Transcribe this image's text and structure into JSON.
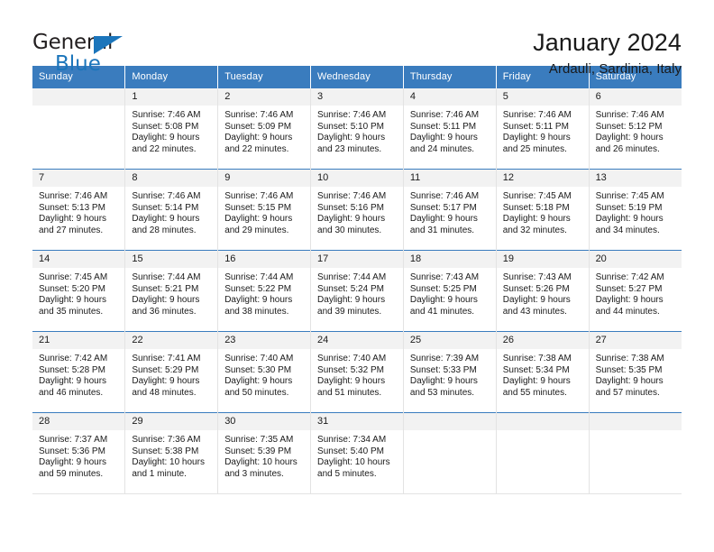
{
  "brand": {
    "name_part1": "General",
    "name_part2": "Blue",
    "triangle_color": "#1b75bb"
  },
  "header": {
    "title": "January 2024",
    "location": "Ardauli, Sardinia, Italy"
  },
  "theme": {
    "header_bg": "#3a7cbe",
    "header_text": "#ffffff",
    "daynum_bg": "#f2f2f2",
    "cell_bg": "#ffffff",
    "grid_line": "#e3e3e3",
    "row_rule": "#3a7cbe"
  },
  "weekdays": [
    "Sunday",
    "Monday",
    "Tuesday",
    "Wednesday",
    "Thursday",
    "Friday",
    "Saturday"
  ],
  "labels": {
    "sunrise_prefix": "Sunrise:",
    "sunset_prefix": "Sunset:",
    "daylight_prefix": "Daylight:"
  },
  "weeks": [
    [
      {
        "day": "",
        "sunrise": "",
        "sunset": "",
        "daylight_line1": "",
        "daylight_line2": ""
      },
      {
        "day": "1",
        "sunrise": "Sunrise: 7:46 AM",
        "sunset": "Sunset: 5:08 PM",
        "daylight_line1": "Daylight: 9 hours",
        "daylight_line2": "and 22 minutes."
      },
      {
        "day": "2",
        "sunrise": "Sunrise: 7:46 AM",
        "sunset": "Sunset: 5:09 PM",
        "daylight_line1": "Daylight: 9 hours",
        "daylight_line2": "and 22 minutes."
      },
      {
        "day": "3",
        "sunrise": "Sunrise: 7:46 AM",
        "sunset": "Sunset: 5:10 PM",
        "daylight_line1": "Daylight: 9 hours",
        "daylight_line2": "and 23 minutes."
      },
      {
        "day": "4",
        "sunrise": "Sunrise: 7:46 AM",
        "sunset": "Sunset: 5:11 PM",
        "daylight_line1": "Daylight: 9 hours",
        "daylight_line2": "and 24 minutes."
      },
      {
        "day": "5",
        "sunrise": "Sunrise: 7:46 AM",
        "sunset": "Sunset: 5:11 PM",
        "daylight_line1": "Daylight: 9 hours",
        "daylight_line2": "and 25 minutes."
      },
      {
        "day": "6",
        "sunrise": "Sunrise: 7:46 AM",
        "sunset": "Sunset: 5:12 PM",
        "daylight_line1": "Daylight: 9 hours",
        "daylight_line2": "and 26 minutes."
      }
    ],
    [
      {
        "day": "7",
        "sunrise": "Sunrise: 7:46 AM",
        "sunset": "Sunset: 5:13 PM",
        "daylight_line1": "Daylight: 9 hours",
        "daylight_line2": "and 27 minutes."
      },
      {
        "day": "8",
        "sunrise": "Sunrise: 7:46 AM",
        "sunset": "Sunset: 5:14 PM",
        "daylight_line1": "Daylight: 9 hours",
        "daylight_line2": "and 28 minutes."
      },
      {
        "day": "9",
        "sunrise": "Sunrise: 7:46 AM",
        "sunset": "Sunset: 5:15 PM",
        "daylight_line1": "Daylight: 9 hours",
        "daylight_line2": "and 29 minutes."
      },
      {
        "day": "10",
        "sunrise": "Sunrise: 7:46 AM",
        "sunset": "Sunset: 5:16 PM",
        "daylight_line1": "Daylight: 9 hours",
        "daylight_line2": "and 30 minutes."
      },
      {
        "day": "11",
        "sunrise": "Sunrise: 7:46 AM",
        "sunset": "Sunset: 5:17 PM",
        "daylight_line1": "Daylight: 9 hours",
        "daylight_line2": "and 31 minutes."
      },
      {
        "day": "12",
        "sunrise": "Sunrise: 7:45 AM",
        "sunset": "Sunset: 5:18 PM",
        "daylight_line1": "Daylight: 9 hours",
        "daylight_line2": "and 32 minutes."
      },
      {
        "day": "13",
        "sunrise": "Sunrise: 7:45 AM",
        "sunset": "Sunset: 5:19 PM",
        "daylight_line1": "Daylight: 9 hours",
        "daylight_line2": "and 34 minutes."
      }
    ],
    [
      {
        "day": "14",
        "sunrise": "Sunrise: 7:45 AM",
        "sunset": "Sunset: 5:20 PM",
        "daylight_line1": "Daylight: 9 hours",
        "daylight_line2": "and 35 minutes."
      },
      {
        "day": "15",
        "sunrise": "Sunrise: 7:44 AM",
        "sunset": "Sunset: 5:21 PM",
        "daylight_line1": "Daylight: 9 hours",
        "daylight_line2": "and 36 minutes."
      },
      {
        "day": "16",
        "sunrise": "Sunrise: 7:44 AM",
        "sunset": "Sunset: 5:22 PM",
        "daylight_line1": "Daylight: 9 hours",
        "daylight_line2": "and 38 minutes."
      },
      {
        "day": "17",
        "sunrise": "Sunrise: 7:44 AM",
        "sunset": "Sunset: 5:24 PM",
        "daylight_line1": "Daylight: 9 hours",
        "daylight_line2": "and 39 minutes."
      },
      {
        "day": "18",
        "sunrise": "Sunrise: 7:43 AM",
        "sunset": "Sunset: 5:25 PM",
        "daylight_line1": "Daylight: 9 hours",
        "daylight_line2": "and 41 minutes."
      },
      {
        "day": "19",
        "sunrise": "Sunrise: 7:43 AM",
        "sunset": "Sunset: 5:26 PM",
        "daylight_line1": "Daylight: 9 hours",
        "daylight_line2": "and 43 minutes."
      },
      {
        "day": "20",
        "sunrise": "Sunrise: 7:42 AM",
        "sunset": "Sunset: 5:27 PM",
        "daylight_line1": "Daylight: 9 hours",
        "daylight_line2": "and 44 minutes."
      }
    ],
    [
      {
        "day": "21",
        "sunrise": "Sunrise: 7:42 AM",
        "sunset": "Sunset: 5:28 PM",
        "daylight_line1": "Daylight: 9 hours",
        "daylight_line2": "and 46 minutes."
      },
      {
        "day": "22",
        "sunrise": "Sunrise: 7:41 AM",
        "sunset": "Sunset: 5:29 PM",
        "daylight_line1": "Daylight: 9 hours",
        "daylight_line2": "and 48 minutes."
      },
      {
        "day": "23",
        "sunrise": "Sunrise: 7:40 AM",
        "sunset": "Sunset: 5:30 PM",
        "daylight_line1": "Daylight: 9 hours",
        "daylight_line2": "and 50 minutes."
      },
      {
        "day": "24",
        "sunrise": "Sunrise: 7:40 AM",
        "sunset": "Sunset: 5:32 PM",
        "daylight_line1": "Daylight: 9 hours",
        "daylight_line2": "and 51 minutes."
      },
      {
        "day": "25",
        "sunrise": "Sunrise: 7:39 AM",
        "sunset": "Sunset: 5:33 PM",
        "daylight_line1": "Daylight: 9 hours",
        "daylight_line2": "and 53 minutes."
      },
      {
        "day": "26",
        "sunrise": "Sunrise: 7:38 AM",
        "sunset": "Sunset: 5:34 PM",
        "daylight_line1": "Daylight: 9 hours",
        "daylight_line2": "and 55 minutes."
      },
      {
        "day": "27",
        "sunrise": "Sunrise: 7:38 AM",
        "sunset": "Sunset: 5:35 PM",
        "daylight_line1": "Daylight: 9 hours",
        "daylight_line2": "and 57 minutes."
      }
    ],
    [
      {
        "day": "28",
        "sunrise": "Sunrise: 7:37 AM",
        "sunset": "Sunset: 5:36 PM",
        "daylight_line1": "Daylight: 9 hours",
        "daylight_line2": "and 59 minutes."
      },
      {
        "day": "29",
        "sunrise": "Sunrise: 7:36 AM",
        "sunset": "Sunset: 5:38 PM",
        "daylight_line1": "Daylight: 10 hours",
        "daylight_line2": "and 1 minute."
      },
      {
        "day": "30",
        "sunrise": "Sunrise: 7:35 AM",
        "sunset": "Sunset: 5:39 PM",
        "daylight_line1": "Daylight: 10 hours",
        "daylight_line2": "and 3 minutes."
      },
      {
        "day": "31",
        "sunrise": "Sunrise: 7:34 AM",
        "sunset": "Sunset: 5:40 PM",
        "daylight_line1": "Daylight: 10 hours",
        "daylight_line2": "and 5 minutes."
      },
      {
        "day": "",
        "sunrise": "",
        "sunset": "",
        "daylight_line1": "",
        "daylight_line2": ""
      },
      {
        "day": "",
        "sunrise": "",
        "sunset": "",
        "daylight_line1": "",
        "daylight_line2": ""
      },
      {
        "day": "",
        "sunrise": "",
        "sunset": "",
        "daylight_line1": "",
        "daylight_line2": ""
      }
    ]
  ]
}
